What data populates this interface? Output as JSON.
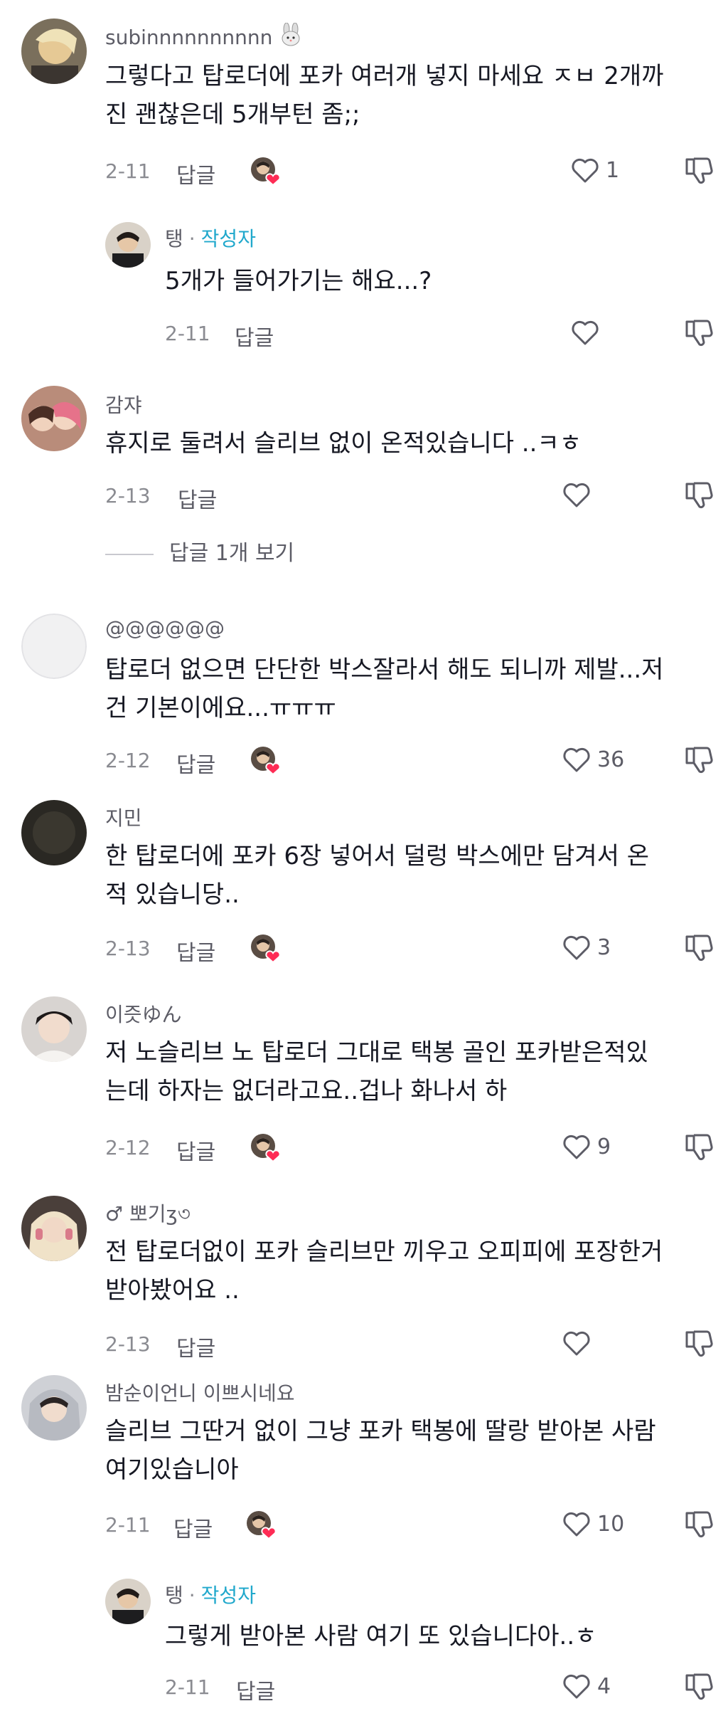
{
  "comments": [
    {
      "username": "subinnnnnnnnnn",
      "username_suffix_icon": "rabbit-face-icon",
      "text_lines": [
        "그렇다고 탑로더에 포카 여러개 넣지 마세요 ㅈㅂ 2개까",
        "진 괜찮은데 5개부턴 좀;;"
      ],
      "date": "2-11",
      "reply_label": "답글",
      "creator_liked": true,
      "like_count": "1",
      "reply": {
        "username": "탱",
        "separator": "·",
        "author_tag": "작성자",
        "text_lines": [
          "5개가 들어가기는 해요...?"
        ],
        "date": "2-11",
        "reply_label": "답글",
        "like_count": ""
      }
    },
    {
      "username": "감쟈",
      "text_lines": [
        "휴지로 둘려서 슬리브 없이 온적있습니다 ..ㅋㅎ"
      ],
      "date": "2-13",
      "reply_label": "답글",
      "creator_liked": false,
      "like_count": "",
      "view_replies": "답글 1개 보기"
    },
    {
      "username": "@@@@@@",
      "text_lines": [
        "탑로더 없으면 단단한 박스잘라서 해도 되니까 제발...저",
        "건 기본이에요...ㅠㅠㅠ"
      ],
      "date": "2-12",
      "reply_label": "답글",
      "creator_liked": true,
      "like_count": "36"
    },
    {
      "username": "지민",
      "text_lines": [
        "한 탑로더에 포카 6장 넣어서 덜렁 박스에만 담겨서 온",
        "적 있습니당.."
      ],
      "date": "2-13",
      "reply_label": "답글",
      "creator_liked": true,
      "like_count": "3"
    },
    {
      "username": "이즛ゆん",
      "text_lines": [
        "저 노슬리브 노 탑로더 그대로 택봉 골인 포카받은적있",
        "는데 하자는 없더라고요..겁나 화나서 하"
      ],
      "date": "2-12",
      "reply_label": "답글",
      "creator_liked": true,
      "like_count": "9"
    },
    {
      "username": "♂ 뽀기ʒ৩",
      "text_lines": [
        "전 탑로더없이 포카 슬리브만 끼우고 오피피에 포장한거",
        "받아봤어요 .."
      ],
      "date": "2-13",
      "reply_label": "답글",
      "creator_liked": false,
      "like_count": ""
    },
    {
      "username": "밤순이언니 이쁘시네요",
      "text_lines": [
        "슬리브 그딴거 없이 그냥 포카 택봉에 딸랑 받아본 사람",
        "여기있습니아"
      ],
      "date": "2-11",
      "reply_label": "답글",
      "creator_liked": true,
      "like_count": "10",
      "reply": {
        "username": "탱",
        "separator": "·",
        "author_tag": "작성자",
        "text_lines": [
          "그렇게 받아본 사람 여기 또 있습니다아..ㅎ"
        ],
        "date": "2-11",
        "reply_label": "답글",
        "like_count": "4"
      }
    }
  ],
  "colors": {
    "text": "#161823",
    "muted": "#8a8b91",
    "author_tag": "#20a8cc",
    "heart_badge": "#fe2c55"
  },
  "icons": {
    "like": "heart-outline-icon",
    "dislike": "thumbs-down-icon",
    "creator_like": "creator-avatar-heart-icon"
  }
}
